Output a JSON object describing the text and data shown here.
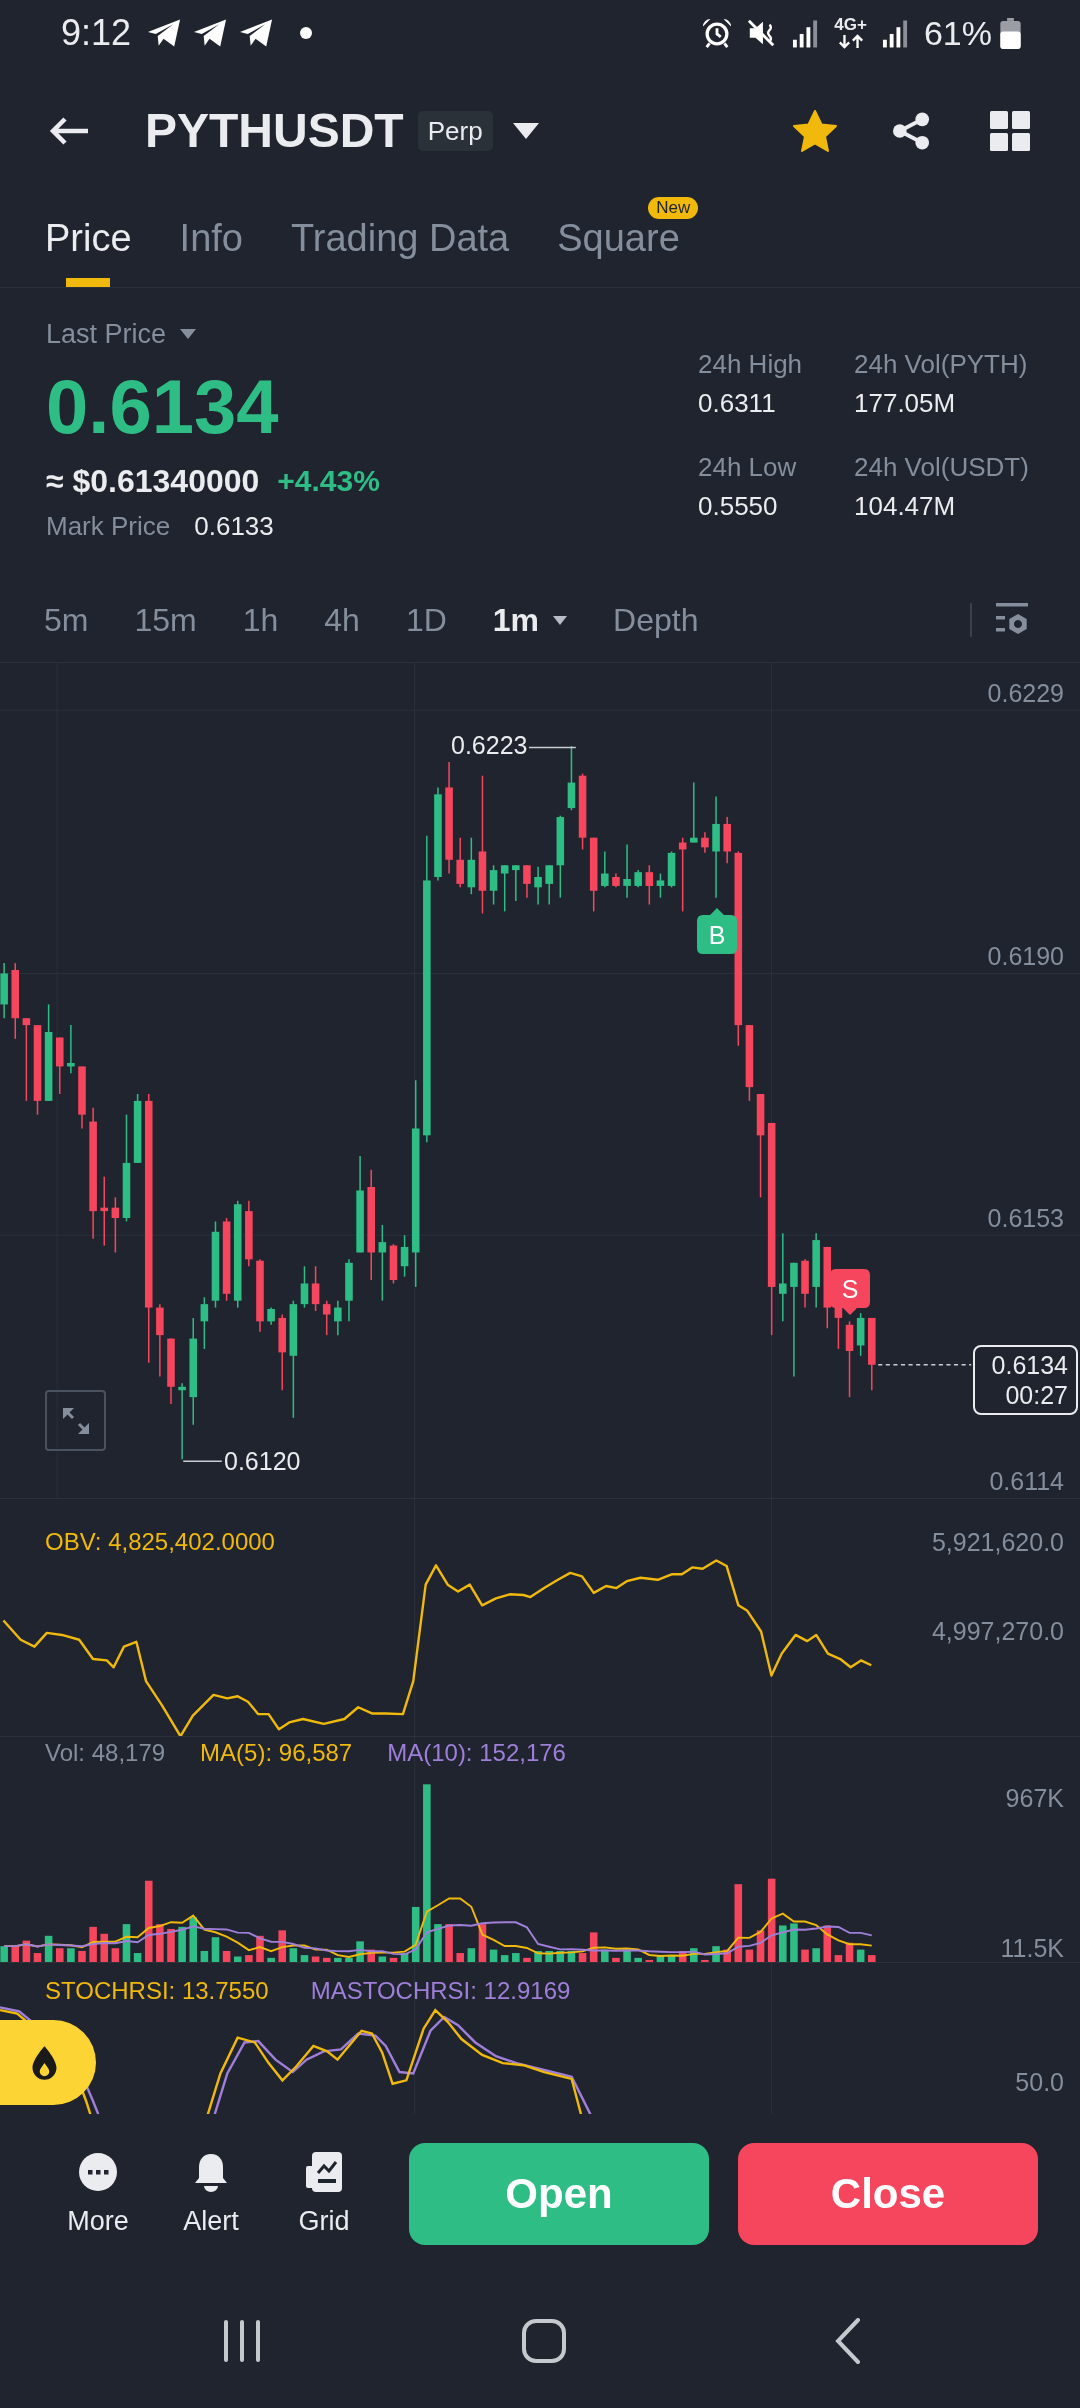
{
  "status_bar": {
    "time": "9:12",
    "network": "4G+",
    "battery": "61%"
  },
  "header": {
    "symbol": "PYTHUSDT",
    "badge": "Perp",
    "favorite": true
  },
  "tabs": [
    {
      "label": "Price",
      "selected": true
    },
    {
      "label": "Info",
      "selected": false
    },
    {
      "label": "Trading Data",
      "selected": false
    },
    {
      "label": "Square",
      "selected": false,
      "badge": "New"
    }
  ],
  "ticker": {
    "price_type": "Last Price",
    "last_price": "0.6134",
    "usd_price": "≈ $0.61340000",
    "change": "+4.43%",
    "mark_label": "Mark Price",
    "mark_price": "0.6133",
    "stats": [
      {
        "label": "24h High",
        "value": "0.6311"
      },
      {
        "label": "24h Vol(PYTH)",
        "value": "177.05M"
      },
      {
        "label": "24h Low",
        "value": "0.5550"
      },
      {
        "label": "24h Vol(USDT)",
        "value": "104.47M"
      }
    ]
  },
  "intervals": [
    {
      "label": "5m",
      "selected": false,
      "dropdown": false
    },
    {
      "label": "15m",
      "selected": false,
      "dropdown": false
    },
    {
      "label": "1h",
      "selected": false,
      "dropdown": false
    },
    {
      "label": "4h",
      "selected": false,
      "dropdown": false
    },
    {
      "label": "1D",
      "selected": false,
      "dropdown": false
    },
    {
      "label": "1m",
      "selected": true,
      "dropdown": true
    },
    {
      "label": "Depth",
      "selected": false,
      "dropdown": false
    }
  ],
  "chart": {
    "price_axis": [
      "0.6229",
      "0.6190",
      "0.6153",
      "0.6114"
    ],
    "high_label": "0.6223",
    "low_label": "0.6120",
    "last_price": "0.6134",
    "countdown": "00:27",
    "markers": [
      {
        "label": "B",
        "kind": "buy"
      },
      {
        "label": "S",
        "kind": "sell"
      }
    ]
  },
  "obv": {
    "label": "OBV: 4,825,402.0000",
    "axis": [
      "5,921,620.0",
      "4,997,270.0"
    ]
  },
  "volume": {
    "label": "Vol: 48,179",
    "ma5": "MA(5): 96,587",
    "ma10": "MA(10): 152,176",
    "axis": [
      "967K",
      "11.5K"
    ]
  },
  "stoch_rsi": {
    "label": "STOCHRSI: 13.7550",
    "ma": "MASTOCHRSI: 12.9169",
    "axis": [
      "50.0"
    ]
  },
  "toolbar": [
    {
      "label": "More"
    },
    {
      "label": "Alert"
    },
    {
      "label": "Grid"
    }
  ],
  "trade_buttons": [
    {
      "label": "Open",
      "kind": "buy"
    },
    {
      "label": "Close",
      "kind": "sell"
    }
  ]
}
